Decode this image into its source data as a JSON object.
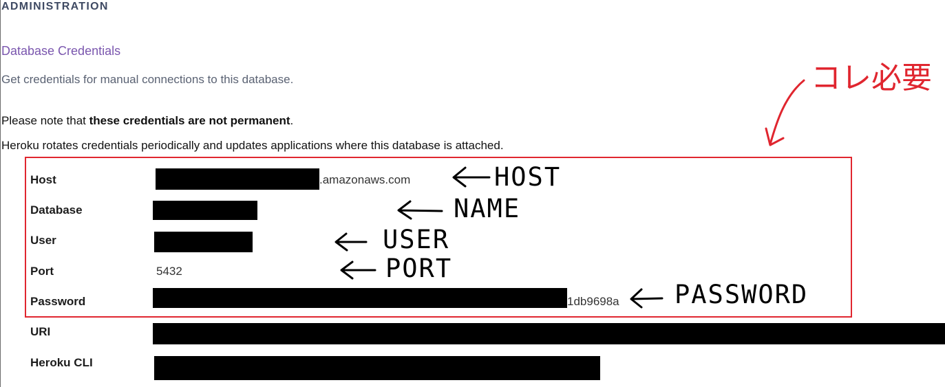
{
  "header": {
    "section": "ADMINISTRATION"
  },
  "credentials": {
    "title": "Database Credentials",
    "subtitle": "Get credentials for manual connections to this database.",
    "note_prefix": "Please note that ",
    "note_bold": "these credentials are not permanent",
    "note_suffix": ".",
    "rotation_note": "Heroku rotates credentials periodically and updates applications where this database is attached.",
    "rows": [
      {
        "label": "Host",
        "value": ".amazonaws.com"
      },
      {
        "label": "Database",
        "value": ""
      },
      {
        "label": "User",
        "value": ""
      },
      {
        "label": "Port",
        "value": "5432"
      },
      {
        "label": "Password",
        "value": "1db9698a"
      },
      {
        "label": "URI",
        "value": ""
      },
      {
        "label": "Heroku CLI",
        "value": ""
      }
    ]
  },
  "annotations": {
    "host": "HOST",
    "name": "NAME",
    "user": "USER",
    "port": "PORT",
    "password": "PASSWORD",
    "required": "コレ必要",
    "color": "#e0262f"
  }
}
